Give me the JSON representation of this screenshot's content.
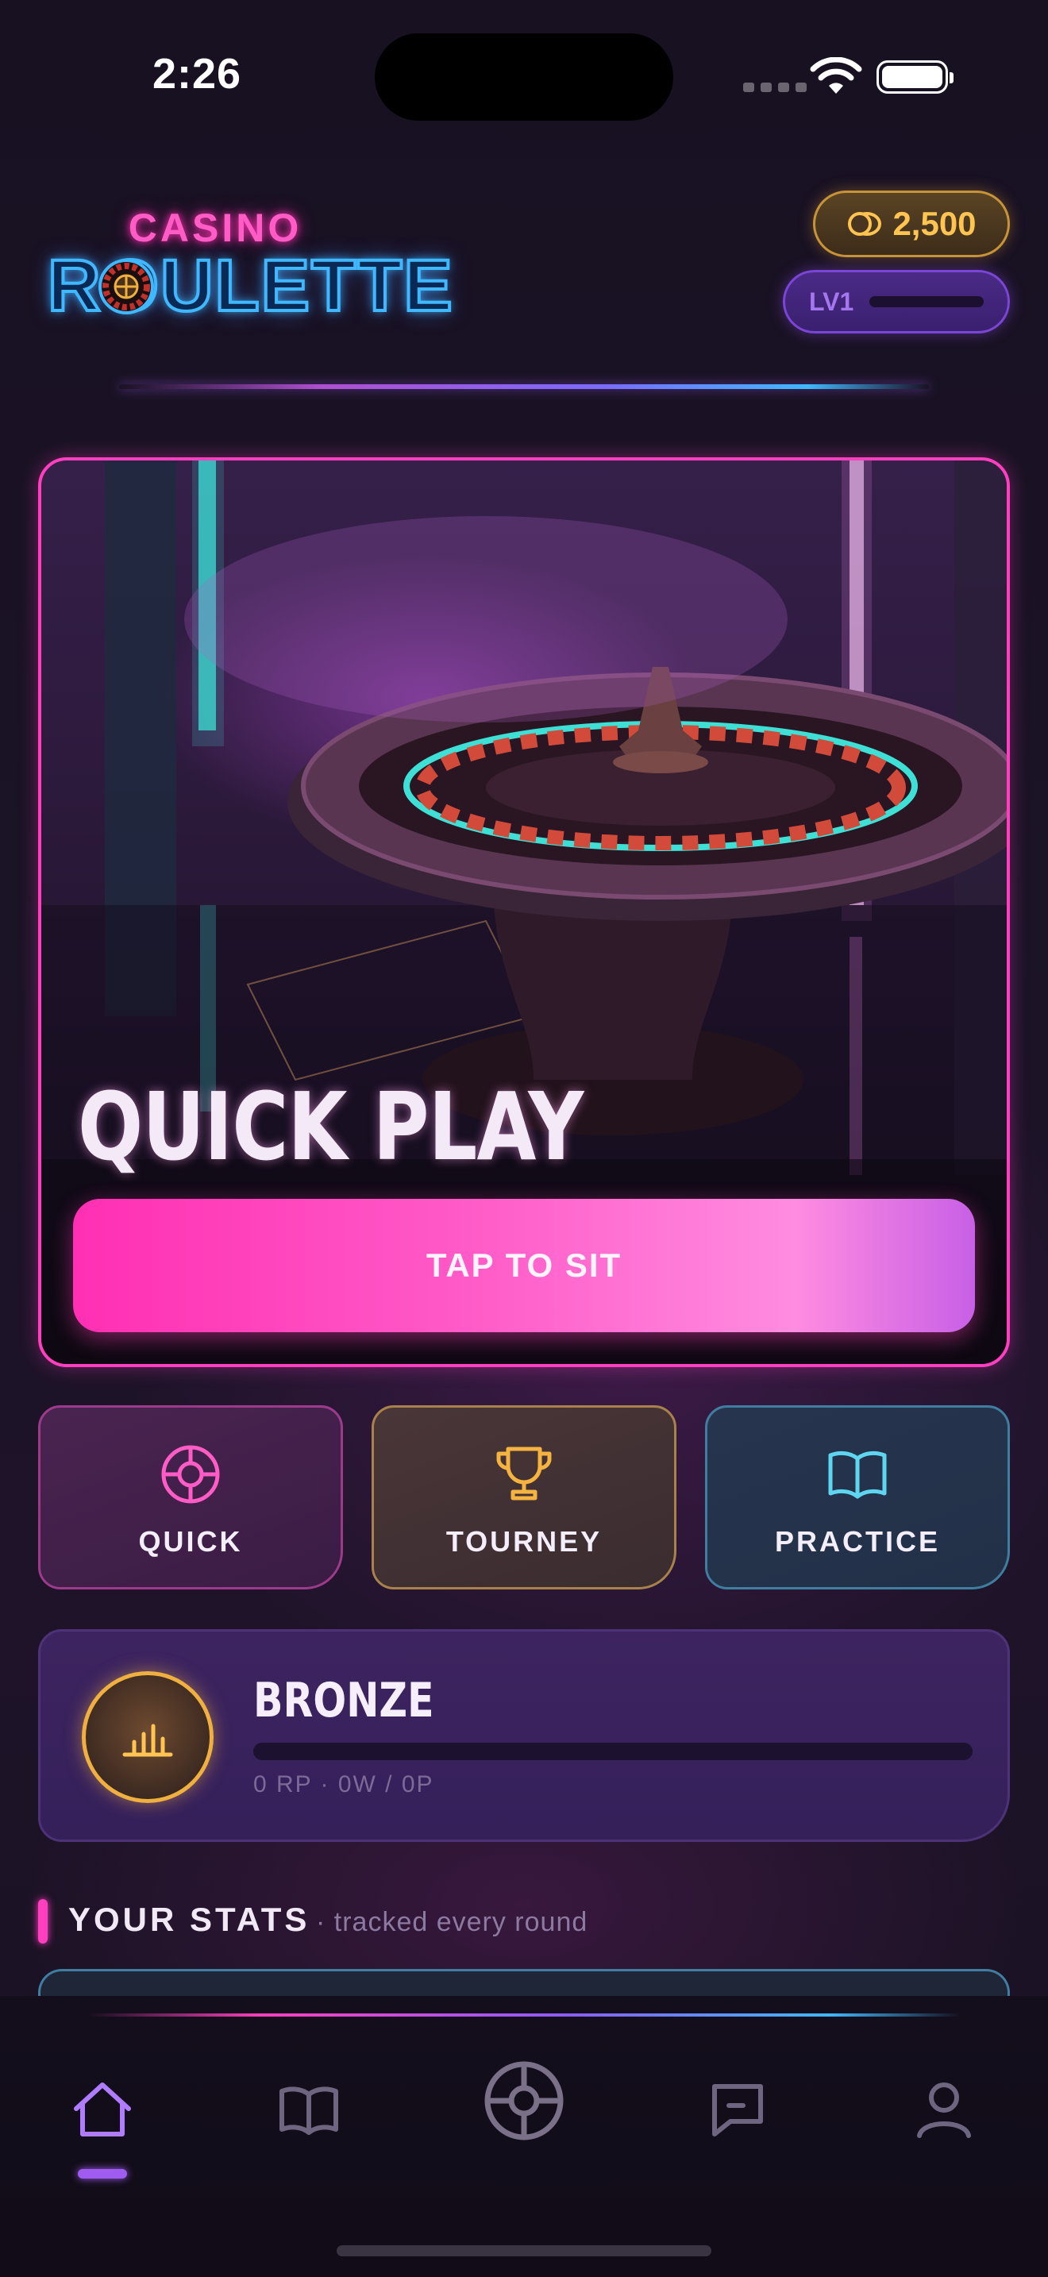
{
  "status_bar": {
    "time": "2:26"
  },
  "header": {
    "logo_top": "CASINO",
    "logo_bottom": "ROULETTE",
    "coins": "2,500",
    "level": "LV1",
    "level_progress": 0
  },
  "hero": {
    "title": "QUICK PLAY",
    "button_label": "TAP TO SIT"
  },
  "modes": [
    {
      "label": "QUICK",
      "icon": "target-icon",
      "color": "#ff5cc6"
    },
    {
      "label": "TOURNEY",
      "icon": "trophy-icon",
      "color": "#f5b440"
    },
    {
      "label": "PRACTICE",
      "icon": "book-icon",
      "color": "#5fd6f0"
    }
  ],
  "rank": {
    "title": "BRONZE",
    "subtitle": "0 RP · 0W / 0P",
    "progress": 0,
    "badge_icon": "bar-chart-icon"
  },
  "stats": {
    "title": "YOUR STATS",
    "subtitle": "· tracked every round"
  },
  "tabbar": {
    "items": [
      {
        "name": "home",
        "icon": "home-icon",
        "active": true
      },
      {
        "name": "learn",
        "icon": "book-icon",
        "active": false
      },
      {
        "name": "play",
        "icon": "roulette-wheel-icon",
        "active": false
      },
      {
        "name": "chat",
        "icon": "chat-icon",
        "active": false
      },
      {
        "name": "profile",
        "icon": "user-icon",
        "active": false
      }
    ]
  },
  "colors": {
    "accent_pink": "#ff3fbf",
    "accent_purple": "#8a5cff",
    "accent_blue": "#3fb8ff",
    "gold": "#ffc451"
  }
}
